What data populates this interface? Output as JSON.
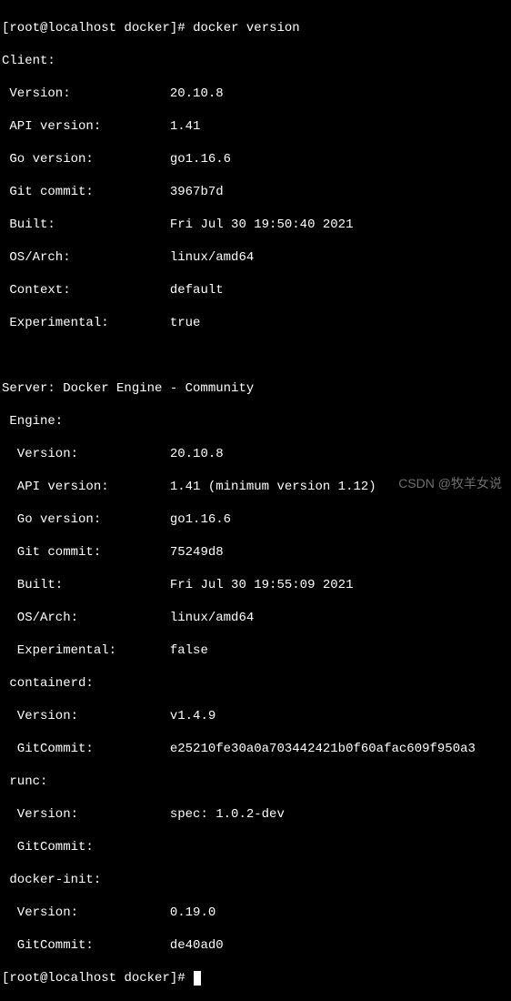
{
  "prompt": {
    "user": "root",
    "host": "localhost",
    "cwd": "docker",
    "symbol": "#",
    "command": "docker version"
  },
  "client": {
    "header": "Client:",
    "version_label": " Version:",
    "version": "20.10.8",
    "api_label": " API version:",
    "api": "1.41",
    "go_label": " Go version:",
    "go": "go1.16.6",
    "commit_label": " Git commit:",
    "commit": "3967b7d",
    "built_label": " Built:",
    "built": "Fri Jul 30 19:50:40 2021",
    "os_label": " OS/Arch:",
    "os": "linux/amd64",
    "context_label": " Context:",
    "context": "default",
    "exp_label": " Experimental:",
    "exp": "true"
  },
  "server": {
    "header": "Server: Docker Engine - Community",
    "engine_label": " Engine:",
    "version_label": "  Version:",
    "version": "20.10.8",
    "api_label": "  API version:",
    "api": "1.41 (minimum version 1.12)",
    "go_label": "  Go version:",
    "go": "go1.16.6",
    "commit_label": "  Git commit:",
    "commit": "75249d8",
    "built_label": "  Built:",
    "built": "Fri Jul 30 19:55:09 2021",
    "os_label": "  OS/Arch:",
    "os": "linux/amd64",
    "exp_label": "  Experimental:",
    "exp": "false",
    "containerd_label": " containerd:",
    "cd_version_label": "  Version:",
    "cd_version": "v1.4.9",
    "cd_commit_label": "  GitCommit:",
    "cd_commit": "e25210fe30a0a703442421b0f60afac609f950a3",
    "runc_label": " runc:",
    "rc_version_label": "  Version:",
    "rc_version": "spec: 1.0.2-dev",
    "rc_commit_label": "  GitCommit:",
    "dockerinit_label": " docker-init:",
    "di_version_label": "  Version:",
    "di_version": "0.19.0",
    "di_commit_label": "  GitCommit:",
    "di_commit": "de40ad0"
  },
  "watermark": "CSDN @牧羊女说"
}
